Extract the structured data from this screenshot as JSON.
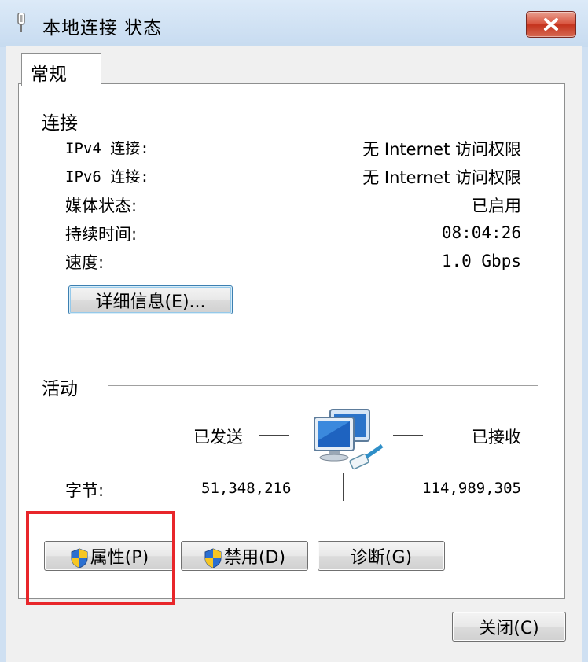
{
  "window": {
    "title": "本地连接 状态",
    "icons": {
      "title": "network-adapter-icon",
      "close": "close-x-icon"
    }
  },
  "tab": {
    "label": "常规"
  },
  "connection": {
    "group_title": "连接",
    "rows": [
      {
        "label": "IPv4 连接:",
        "value": "无 Internet 访问权限"
      },
      {
        "label": "IPv6 连接:",
        "value": "无 Internet 访问权限"
      },
      {
        "label": "媒体状态:",
        "value": "已启用"
      },
      {
        "label": "持续时间:",
        "value": "08:04:26"
      },
      {
        "label": "速度:",
        "value": "1.0 Gbps"
      }
    ],
    "details_button": "详细信息(E)..."
  },
  "activity": {
    "group_title": "活动",
    "sent_label": "已发送",
    "received_label": "已接收",
    "bytes_label": "字节:",
    "bytes_sent": "51,348,216",
    "bytes_received": "114,989,305",
    "network_icon": "network-computers-icon"
  },
  "buttons": {
    "properties": "属性(P)",
    "disable": "禁用(D)",
    "diagnose": "诊断(G)",
    "close": "关闭(C)"
  },
  "colors": {
    "highlight_box": "#e8262a",
    "focus_border": "#3c7fb1",
    "title_gradient": "#dceaf8"
  }
}
